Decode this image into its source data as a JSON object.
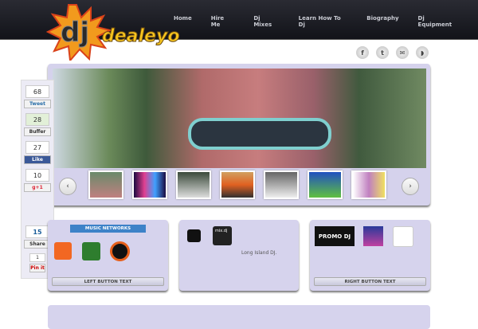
{
  "logo": {
    "text": "djdealeyo"
  },
  "nav": [
    "Home",
    "Hire Me",
    "Dj Mixes",
    "Learn How To Dj",
    "Biography",
    "Dj Equipment"
  ],
  "social": [
    {
      "icon": "facebook-icon",
      "glyph": "f"
    },
    {
      "icon": "twitter-icon",
      "glyph": "t"
    },
    {
      "icon": "email-icon",
      "glyph": "✉"
    },
    {
      "icon": "rss-icon",
      "glyph": "◗"
    }
  ],
  "slider": {
    "prev": "‹",
    "next": "›",
    "thumbs": 7
  },
  "share": {
    "tweet_count": "68",
    "tweet": "Tweet",
    "buffer_count": "28",
    "buffer": "Buffer",
    "like_count": "27",
    "like": "Like",
    "plus_count": "10",
    "plus": "g+1",
    "linkedin_count": "15",
    "linkedin": "Share",
    "pin_count": "1",
    "pin": "Pin it"
  },
  "boxes": {
    "left_title": "MUSIC NETWORKS",
    "left_button": "LEFT BUTTON TEXT",
    "middle_text": "Long Island DJ.",
    "right_button": "RIGHT BUTTON TEXT",
    "promo": "PROMO DJ",
    "mixdj": "mix.dj"
  }
}
